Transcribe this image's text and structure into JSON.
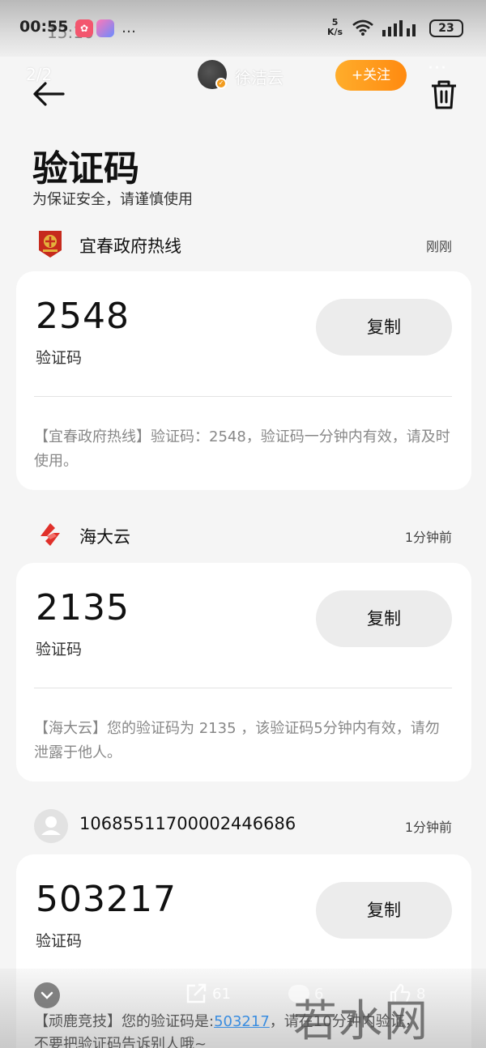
{
  "status_bar": {
    "time": "00:55",
    "ghost_time": "15:16",
    "more": "…",
    "net_speed_value": "5",
    "net_speed_unit": "K/s",
    "battery": "23"
  },
  "post_header": {
    "page_counter": "2/2",
    "author_name": "徐洁云",
    "follow_label": "+关注",
    "more": "···"
  },
  "page": {
    "title": "验证码",
    "subtitle": "为保证安全，请谨慎使用"
  },
  "messages": [
    {
      "sender": "宜春政府热线",
      "time": "刚刚",
      "code": "2548",
      "code_label": "验证码",
      "copy_label": "复制",
      "text": "【宜春政府热线】验证码：2548，验证码一分钟内有效，请及时使用。"
    },
    {
      "sender": "海大云",
      "time": "1分钟前",
      "code": "2135",
      "code_label": "验证码",
      "copy_label": "复制",
      "text": "【海大云】您的验证码为 2135 ，该验证码5分钟内有效，请勿泄露于他人。"
    },
    {
      "sender": "10685511700002446686",
      "time": "1分钟前",
      "code": "503217",
      "code_label": "验证码",
      "copy_label": "复制"
    }
  ],
  "bottom_overlay": {
    "share_count": "61",
    "comment_count": "6",
    "like_count": "8",
    "watermark": "若水网",
    "message_prefix": "【顽鹿竞技】您的验证码是:",
    "message_code": "503217",
    "message_suffix": "，请在10分钟内验证，",
    "message_line2": "不要把验证码告诉别人哦~"
  },
  "colors": {
    "background": "#f5f5f5",
    "card": "#ffffff",
    "follow_button": "#ff9a1a",
    "copy_button": "#ececec",
    "message_text": "#888888"
  }
}
